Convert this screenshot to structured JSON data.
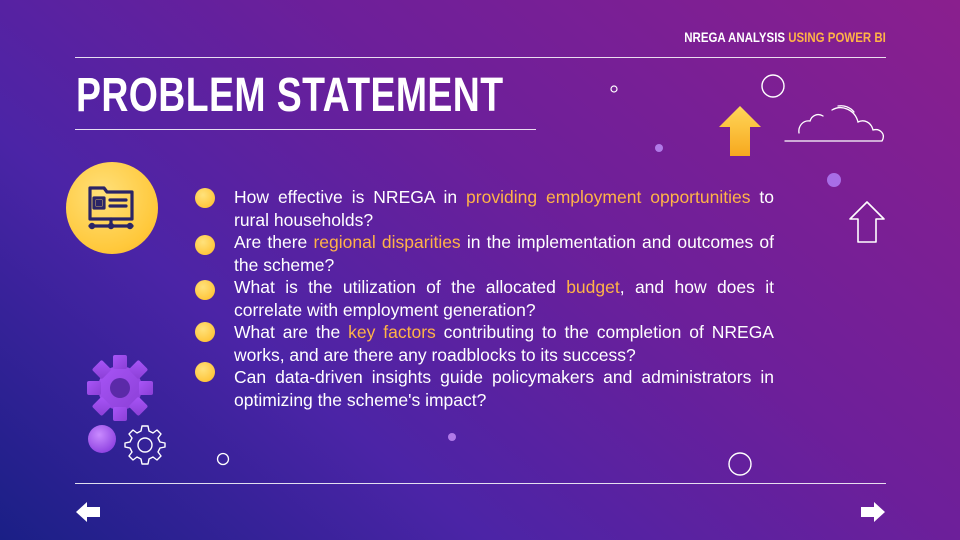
{
  "header": {
    "brand_prefix": "NREGA ANALYSIS",
    "brand_accent": "USING POWER BI"
  },
  "title": "PROBLEM STATEMENT",
  "questions": [
    {
      "before": "How effective is NREGA in ",
      "highlight": "providing employment opportunities",
      "after": " to rural households?"
    },
    {
      "before": "Are there ",
      "highlight": "regional disparities",
      "after": " in the implementation and outcomes of the scheme?"
    },
    {
      "before": "What is the utilization of the allocated ",
      "highlight": "budget",
      "after": ", and how does it correlate with employment generation?"
    },
    {
      "before": "What are the ",
      "highlight": "key factors",
      "after": " contributing to the completion of NREGA works, and are there any roadblocks to its success?"
    },
    {
      "before": "Can data-driven insights guide policymakers and administrators in optimizing the scheme's impact?",
      "highlight": "",
      "after": ""
    }
  ],
  "icons": {
    "badge": "data-dashboard-icon",
    "gear": "gear-icon",
    "gear_outline": "gear-outline-icon",
    "up_arrow": "up-arrow-icon",
    "cloud": "cloud-icon",
    "prev": "left-arrow-icon",
    "next": "right-arrow-icon"
  },
  "colors": {
    "accent": "#ffb347",
    "bullet": "#ffc53a",
    "text": "#ffffff"
  }
}
